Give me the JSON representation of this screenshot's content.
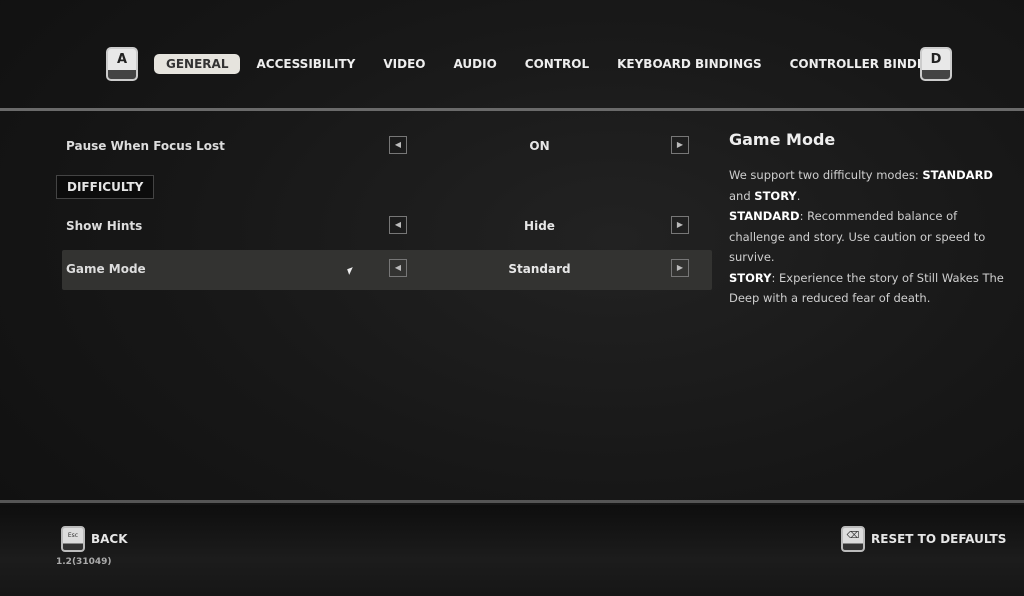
{
  "nav": {
    "prev_key": "A",
    "next_key": "D",
    "tabs": [
      {
        "label": "GENERAL",
        "active": true
      },
      {
        "label": "ACCESSIBILITY"
      },
      {
        "label": "VIDEO"
      },
      {
        "label": "AUDIO"
      },
      {
        "label": "CONTROL"
      },
      {
        "label": "KEYBOARD BINDINGS"
      },
      {
        "label": "CONTROLLER BINDINGS"
      }
    ]
  },
  "settings": {
    "pause": {
      "label": "Pause When Focus Lost",
      "value": "ON"
    },
    "section": "DIFFICULTY",
    "hints": {
      "label": "Show Hints",
      "value": "Hide"
    },
    "mode": {
      "label": "Game Mode",
      "value": "Standard",
      "selected": true
    }
  },
  "info": {
    "title": "Game Mode",
    "p1a": "We support two difficulty modes: ",
    "p1b": "STANDARD",
    "p1c": " and ",
    "p1d": "STORY",
    "p1e": ".",
    "p2a": "STANDARD",
    "p2b": ": Recommended balance of challenge and story. Use caution or speed to survive.",
    "p3a": "STORY",
    "p3b": ": Experience the story of Still Wakes The Deep with a reduced fear of death."
  },
  "footer": {
    "back_key": "Esc",
    "back": "BACK",
    "version": "1.2(31049)",
    "reset_key": "⌫",
    "reset": "RESET TO DEFAULTS"
  }
}
